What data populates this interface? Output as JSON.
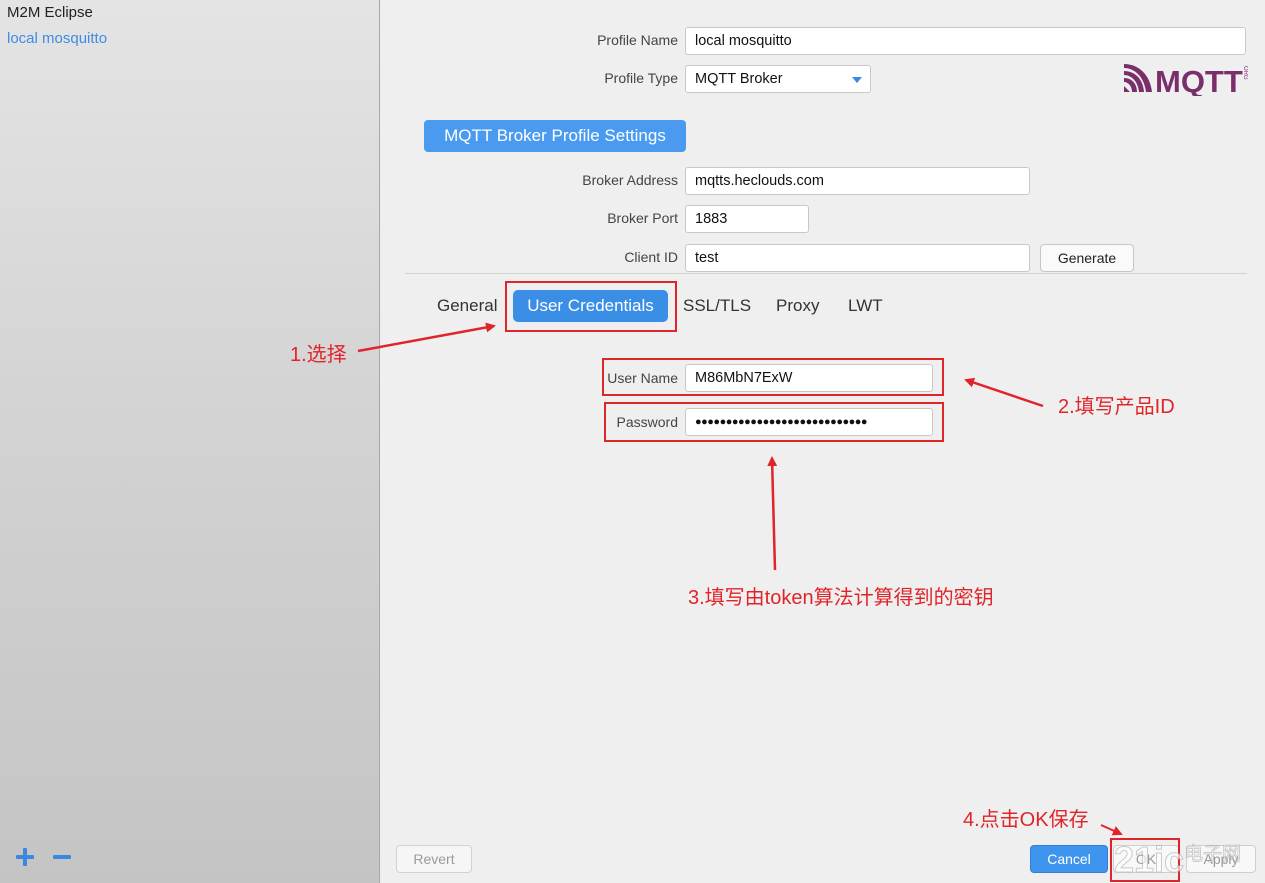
{
  "sidebar": {
    "items": [
      {
        "label": "M2M Eclipse"
      },
      {
        "label": "local mosquitto"
      }
    ]
  },
  "profile": {
    "name_label": "Profile Name",
    "name_value": "local mosquitto",
    "type_label": "Profile Type",
    "type_value": "MQTT Broker"
  },
  "logo_text": "MQTT",
  "logo_sub": "ORG",
  "section_title": "MQTT Broker Profile Settings",
  "broker": {
    "address_label": "Broker Address",
    "address_value": "mqtts.heclouds.com",
    "port_label": "Broker Port",
    "port_value": "1883",
    "client_id_label": "Client ID",
    "client_id_value": "test",
    "generate_label": "Generate"
  },
  "tabs": [
    {
      "label": "General"
    },
    {
      "label": "User Credentials",
      "active": true
    },
    {
      "label": "SSL/TLS"
    },
    {
      "label": "Proxy"
    },
    {
      "label": "LWT"
    }
  ],
  "credentials": {
    "user_label": "User Name",
    "user_value": "M86MbN7ExW",
    "password_label": "Password",
    "password_value": "●●●●●●●●●●●●●●●●●●●●●●●●●●●●"
  },
  "annotations": {
    "step1": "1.选择",
    "step2": "2.填写产品ID",
    "step3": "3.填写由token算法计算得到的密钥",
    "step4": "4.点击OK保存"
  },
  "footer": {
    "revert": "Revert",
    "cancel": "Cancel",
    "ok": "OK",
    "apply": "Apply"
  },
  "watermark": {
    "brand": "21ic",
    "text": "电子网"
  },
  "colors": {
    "accent": "#3a8ee6",
    "annotation": "#e0252a",
    "logo": "#7a2f6a"
  }
}
